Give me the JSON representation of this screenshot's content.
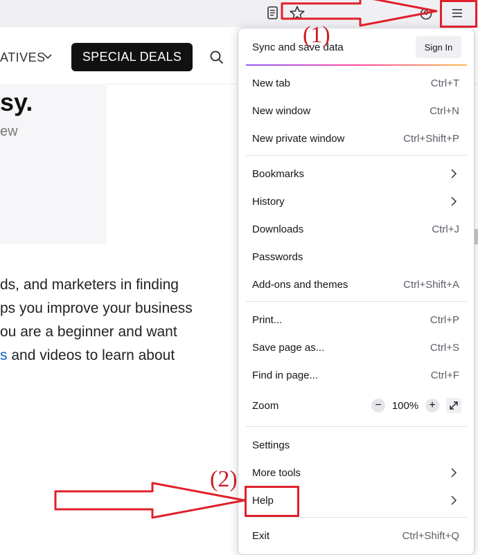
{
  "browser": {
    "reader_icon": "reader-view-icon",
    "bookmark_icon": "star-icon",
    "account_icon": "account-icon",
    "menu_icon": "hamburger-menu-icon"
  },
  "page": {
    "nav_partial": "ATIVES",
    "special_deals": "SPECIAL DEALS",
    "hero_title": "sy.",
    "hero_sub": "ew",
    "body_lines": [
      "ds, and marketers in finding",
      "ps you improve your business",
      "ou are a beginner and want"
    ],
    "body_link": "s",
    "body_last": " and videos to learn about"
  },
  "menu": {
    "sync_label": "Sync and save data",
    "sign_in": "Sign In",
    "new_tab": "New tab",
    "new_tab_sc": "Ctrl+T",
    "new_window": "New window",
    "new_window_sc": "Ctrl+N",
    "new_private": "New private window",
    "new_private_sc": "Ctrl+Shift+P",
    "bookmarks": "Bookmarks",
    "history": "History",
    "downloads": "Downloads",
    "downloads_sc": "Ctrl+J",
    "passwords": "Passwords",
    "addons": "Add-ons and themes",
    "addons_sc": "Ctrl+Shift+A",
    "print": "Print...",
    "print_sc": "Ctrl+P",
    "save_page": "Save page as...",
    "save_page_sc": "Ctrl+S",
    "find": "Find in page...",
    "find_sc": "Ctrl+F",
    "zoom": "Zoom",
    "zoom_value": "100%",
    "zoom_minus": "−",
    "zoom_plus": "+",
    "settings": "Settings",
    "more_tools": "More tools",
    "help": "Help",
    "exit": "Exit",
    "exit_sc": "Ctrl+Shift+Q"
  },
  "annotations": {
    "step1": "(1)",
    "step2": "(2)",
    "color": "#e0202a"
  }
}
